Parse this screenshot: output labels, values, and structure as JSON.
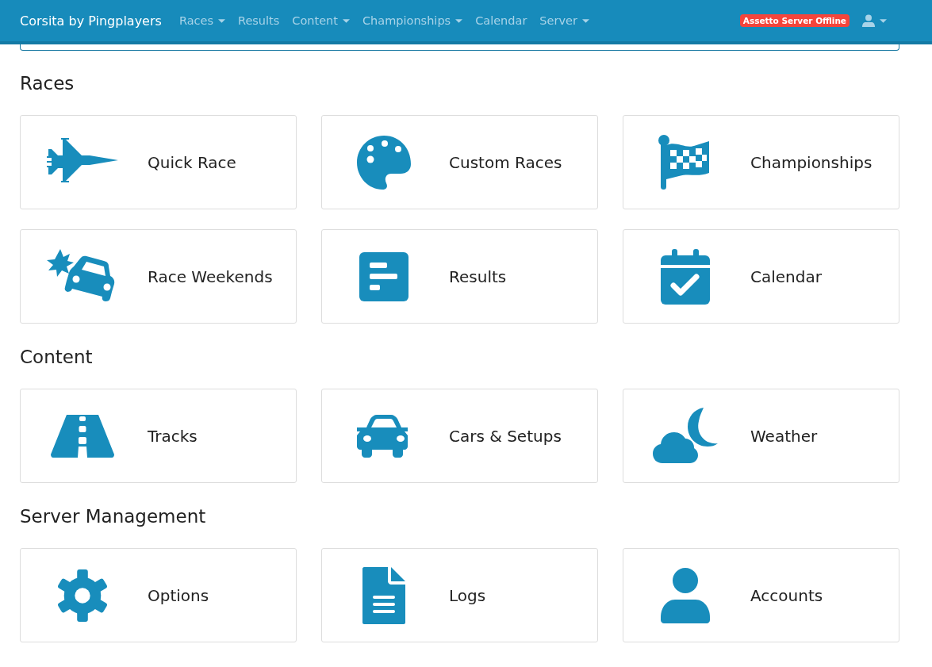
{
  "navbar": {
    "brand": "Corsita by Pingplayers",
    "items": [
      {
        "label": "Races",
        "dropdown": true
      },
      {
        "label": "Results",
        "dropdown": false
      },
      {
        "label": "Content",
        "dropdown": true
      },
      {
        "label": "Championships",
        "dropdown": true
      },
      {
        "label": "Calendar",
        "dropdown": false
      },
      {
        "label": "Server",
        "dropdown": true
      }
    ],
    "status_badge": "Assetto Server Offline",
    "user_menu": {
      "dropdown": true
    }
  },
  "sections": [
    {
      "title": "Races",
      "tiles": [
        {
          "label": "Quick Race"
        },
        {
          "label": "Custom Races"
        },
        {
          "label": "Championships"
        },
        {
          "label": "Race Weekends"
        },
        {
          "label": "Results"
        },
        {
          "label": "Calendar"
        }
      ]
    },
    {
      "title": "Content",
      "tiles": [
        {
          "label": "Tracks"
        },
        {
          "label": "Cars & Setups"
        },
        {
          "label": "Weather"
        }
      ]
    },
    {
      "title": "Server Management",
      "tiles": [
        {
          "label": "Options"
        },
        {
          "label": "Logs"
        },
        {
          "label": "Accounts"
        }
      ]
    }
  ]
}
